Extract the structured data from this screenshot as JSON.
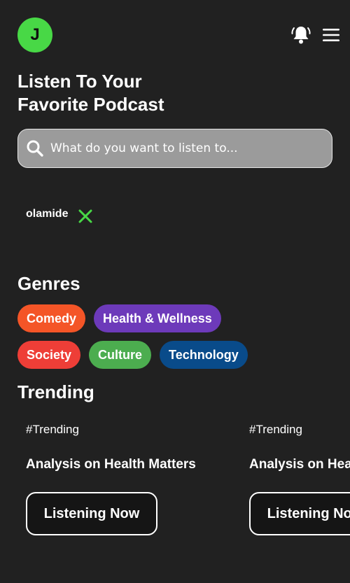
{
  "colors": {
    "background": "#212121",
    "avatar": "#48d846",
    "search_background": "#9b9b9b",
    "close_icon": "#48d846",
    "button_background": "#151515"
  },
  "header": {
    "avatar_initial": "J",
    "notification_icon": "bell-icon",
    "menu_icon": "hamburger-menu-icon"
  },
  "title": {
    "line1": "Listen To Your",
    "line2": "Favorite Podcast"
  },
  "search": {
    "placeholder": "What do you want to listen to...",
    "value": "",
    "icon": "search-icon"
  },
  "recent": {
    "label": "olamide",
    "remove_icon": "close-icon"
  },
  "genres": {
    "title": "Genres",
    "items": [
      {
        "label": "Comedy",
        "color": "#f45527"
      },
      {
        "label": "Health & Wellness",
        "color": "#6d3aba"
      },
      {
        "label": "Society",
        "color": "#ee3e37"
      },
      {
        "label": "Culture",
        "color": "#4cad4f"
      },
      {
        "label": "Technology",
        "color": "#094b8a"
      }
    ]
  },
  "trending": {
    "title": "Trending",
    "cards": [
      {
        "tag": "#Trending",
        "headline": "Analysis on Health Matters",
        "button": "Listening Now"
      },
      {
        "tag": "#Trending",
        "headline": "Analysis on Health Matters",
        "button": "Listening Now"
      }
    ]
  }
}
